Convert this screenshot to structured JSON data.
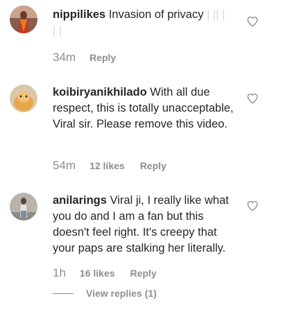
{
  "comments": [
    {
      "username": "nippilikes",
      "text": "Invasion of privacy",
      "faded_text": "| || |",
      "faded_text_line2": "| |",
      "time": "34m",
      "reply_label": "Reply"
    },
    {
      "username": "koibiryanikhilado",
      "text": "With all due respect, this is totally unacceptable, Viral sir. Please remove this video.",
      "time": "54m",
      "likes": "12 likes",
      "reply_label": "Reply"
    },
    {
      "username": "anilarings",
      "text": "Viral ji, I really like what you do and I am a fan but this doesn't feel right. It's creepy that your paps are stalking her literally.",
      "time": "1h",
      "likes": "16 likes",
      "reply_label": "Reply",
      "view_replies_label": "View replies (1)"
    }
  ],
  "icons": {
    "heart": "heart-outline-icon"
  },
  "colors": {
    "primary_text": "#262626",
    "secondary_text": "#8e8e8e"
  }
}
